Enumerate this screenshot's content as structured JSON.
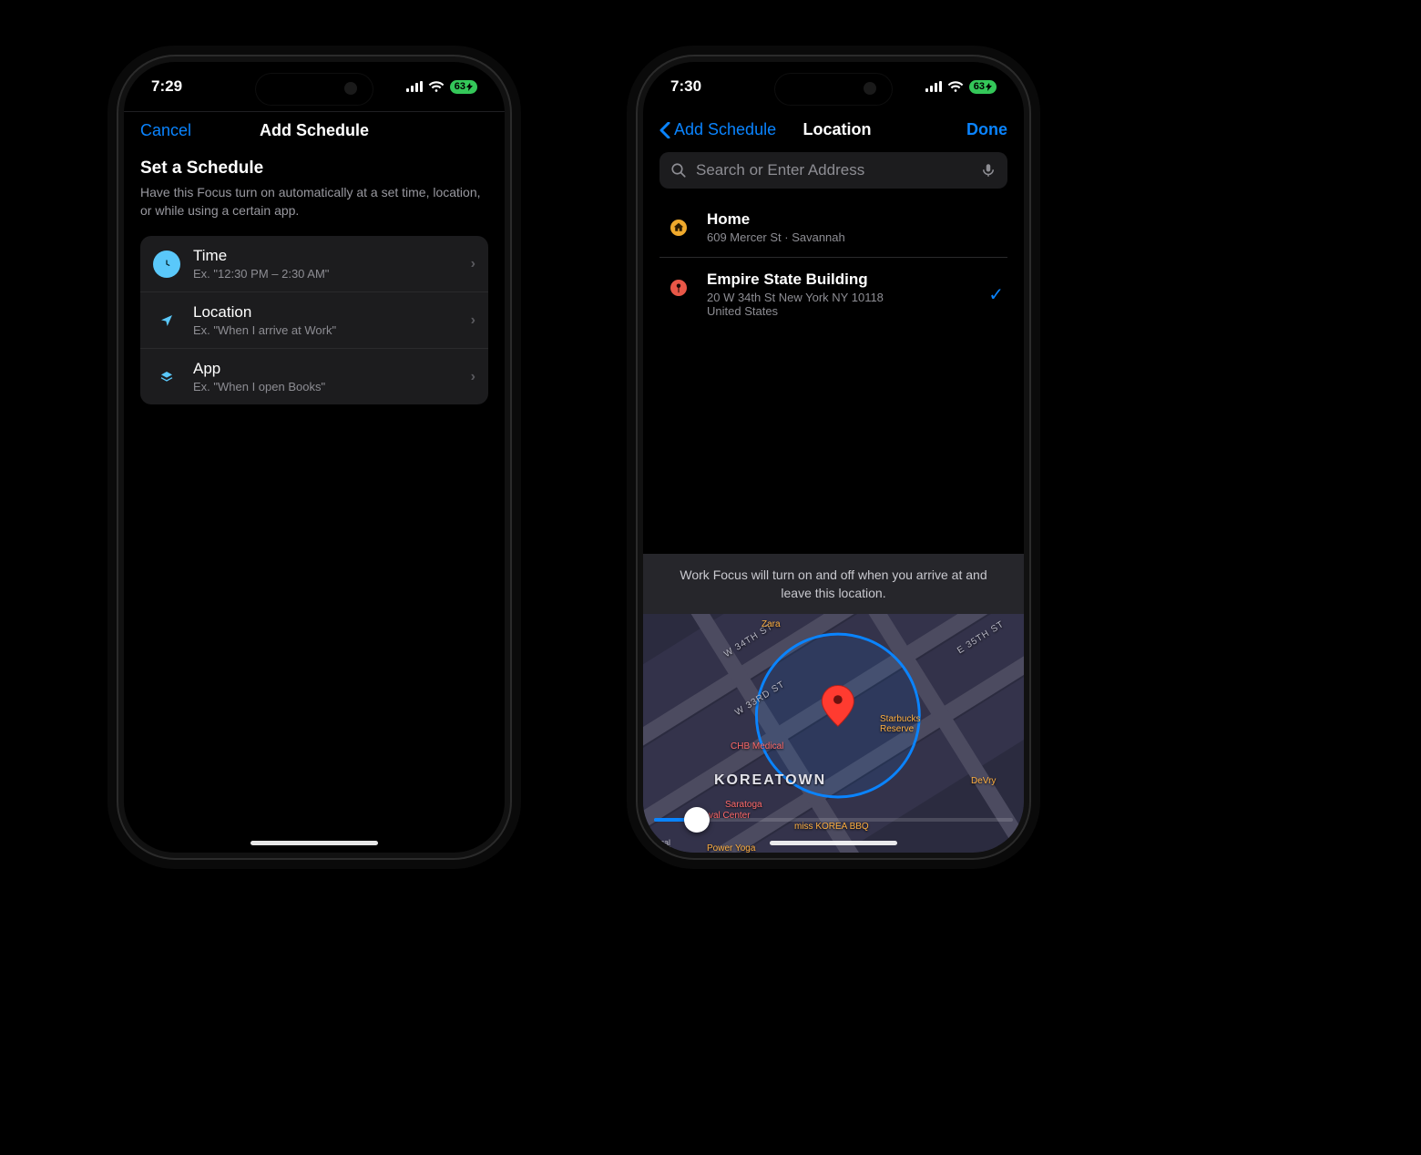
{
  "status": {
    "left_time": "7:29",
    "right_time": "7:30",
    "battery": "63"
  },
  "left": {
    "nav": {
      "cancel": "Cancel",
      "title": "Add Schedule"
    },
    "section_title": "Set a Schedule",
    "section_sub": "Have this Focus turn on automatically at a set time, location, or while using a certain app.",
    "rows": {
      "time": {
        "title": "Time",
        "sub": "Ex. \"12:30 PM – 2:30 AM\""
      },
      "location": {
        "title": "Location",
        "sub": "Ex. \"When I arrive at Work\""
      },
      "app": {
        "title": "App",
        "sub": "Ex. \"When I open Books\""
      }
    }
  },
  "right": {
    "nav": {
      "back": "Add Schedule",
      "title": "Location",
      "done": "Done"
    },
    "search_placeholder": "Search or Enter Address",
    "results": {
      "home": {
        "title": "Home",
        "sub": "609 Mercer St · Savannah"
      },
      "empire": {
        "title": "Empire State Building",
        "sub": "20 W 34th St New York NY 10118\nUnited States"
      }
    },
    "caption": "Work Focus will turn on and off when you arrive at and leave this location.",
    "map": {
      "streets": {
        "w34": "W 34TH ST",
        "w33": "W 33RD ST",
        "e35": "E 35TH ST"
      },
      "district": "KOREATOWN",
      "pois": {
        "starbucks": "Starbucks Reserve",
        "chb": "CHB Medical",
        "devry": "DeVry",
        "saratoga": "Saratoga",
        "center": "val Center",
        "misskorea": "miss KOREA BBQ",
        "yoga": "Power Yoga",
        "zara": "Zara"
      },
      "legal": "Legal"
    }
  }
}
